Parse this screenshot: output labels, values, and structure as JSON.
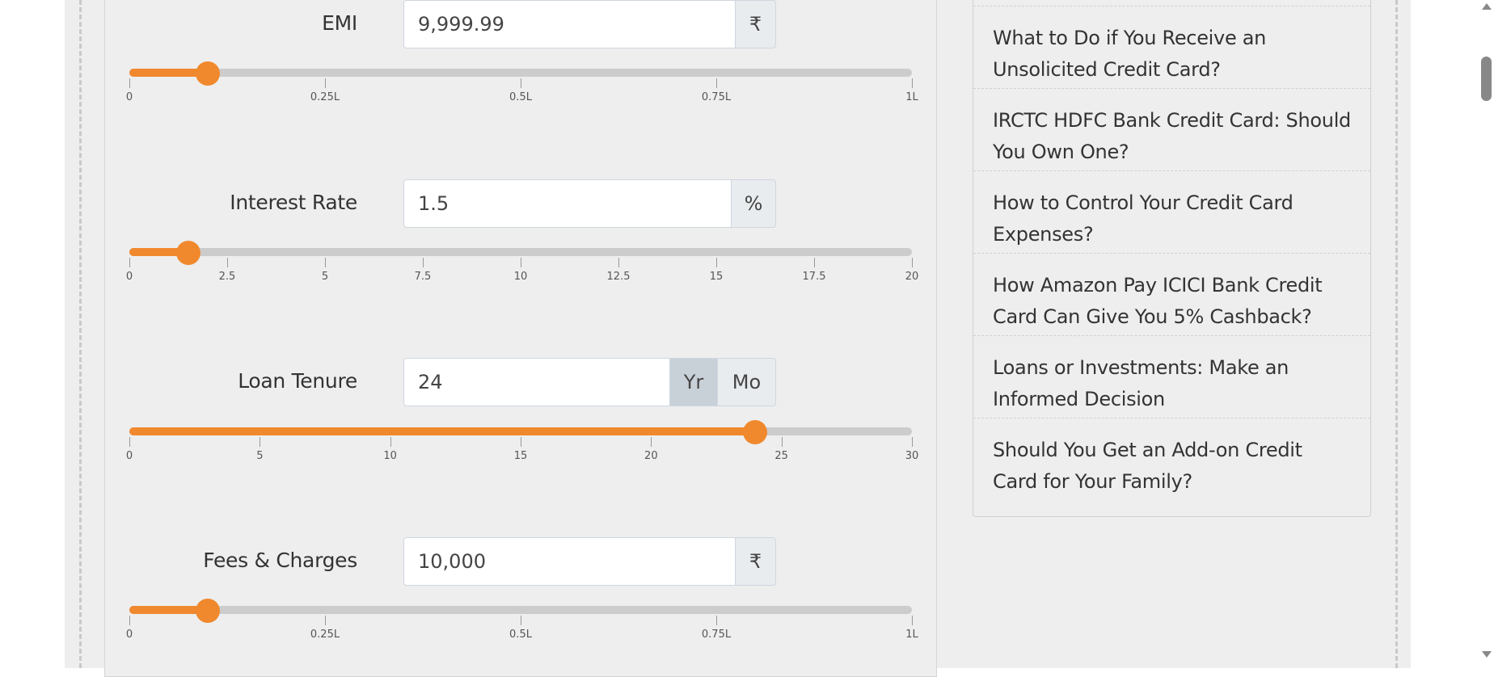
{
  "calculator": {
    "fields": [
      {
        "label": "EMI",
        "value": "9,999.99",
        "addons": [
          "₹"
        ],
        "slider": {
          "fraction": 0.1,
          "ticks": [
            "0",
            "0.25L",
            "0.5L",
            "0.75L",
            "1L"
          ]
        }
      },
      {
        "label": "Interest Rate",
        "value": "1.5",
        "addons": [
          "%"
        ],
        "slider": {
          "fraction": 0.075,
          "ticks": [
            "0",
            "2.5",
            "5",
            "7.5",
            "10",
            "12.5",
            "15",
            "17.5",
            "20"
          ]
        }
      },
      {
        "label": "Loan Tenure",
        "value": "24",
        "addons": [
          "Yr",
          "Mo"
        ],
        "active_addon": "Yr",
        "slider": {
          "fraction": 0.8,
          "ticks": [
            "0",
            "5",
            "10",
            "15",
            "20",
            "25",
            "30"
          ]
        }
      },
      {
        "label": "Fees & Charges",
        "value": "10,000",
        "addons": [
          "₹"
        ],
        "slider": {
          "fraction": 0.1,
          "ticks": [
            "0",
            "0.25L",
            "0.5L",
            "0.75L",
            "1L"
          ]
        }
      }
    ]
  },
  "sidebar": {
    "items": [
      {
        "label": "What to Do if You Receive an Unsolicited Credit Card?"
      },
      {
        "label": "IRCTC HDFC Bank Credit Card: Should You Own One?"
      },
      {
        "label": "How to Control Your Credit Card Expenses?"
      },
      {
        "label": "How Amazon Pay ICICI Bank Credit Card Can Give You 5% Cashback?"
      },
      {
        "label": "Loans or Investments: Make an Informed Decision"
      },
      {
        "label": "Should You Get an Add-on Credit Card for Your Family?"
      }
    ]
  },
  "colors": {
    "accent": "#f0892e",
    "track": "#cccccc",
    "page_bg": "#eeeeee"
  }
}
